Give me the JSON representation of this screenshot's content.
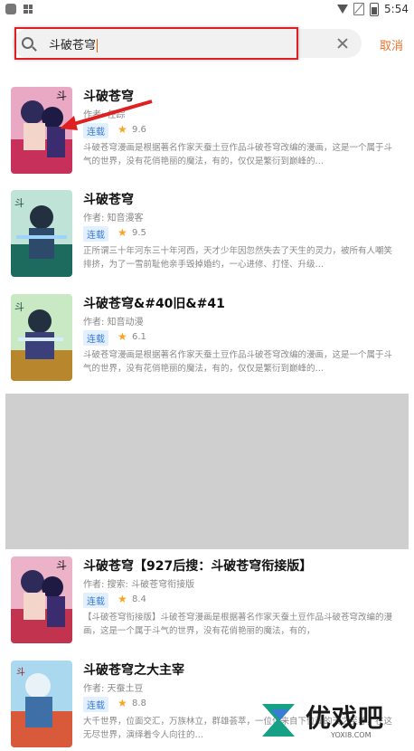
{
  "status": {
    "time": "5:54"
  },
  "search": {
    "query": "斗破苍穹",
    "cancel": "取消"
  },
  "results": [
    {
      "title": "斗破苍穹",
      "author": "作者: 任踪",
      "tag": "连载",
      "score": "9.6",
      "desc": "斗破苍穹漫画是根据著名作家天蚕土豆作品斗破苍穹改编的漫画，这是一个属于斗气的世界，没有花俏艳丽的魔法，有的，仅仅是繁衍到巅峰的…"
    },
    {
      "title": "斗破苍穹",
      "author": "作者: 知音漫客",
      "tag": "连载",
      "score": "9.5",
      "desc": "正所谓三十年河东三十年河西，天才少年因忽然失去了天生的灵力，被所有人嘲笑排挤，为了一雪前耻他亲手毁掉婚约，一心进修、打怪、升级…"
    },
    {
      "title": "斗破苍穹&#40旧&#41",
      "author": "作者: 知音动漫",
      "tag": "连载",
      "score": "6.1",
      "desc": "斗破苍穹漫画是根据著名作家天蚕土豆作品斗破苍穹改编的漫画，这是一个属于斗气的世界，没有花俏艳丽的魔法，有的，仅仅是繁衍到巅峰的…"
    },
    {
      "title": "斗破苍穹【927后搜：斗破苍穹衔接版】",
      "author": "作者: 搜索: 斗破苍穹衔接版",
      "tag": "连载",
      "score": "8.4",
      "desc": "【斗破苍穹衔接版】斗破苍穹漫画是根据著名作家天蚕土豆作品斗破苍穹改编的漫画，这是一个属于斗气的世界，没有花俏艳丽的魔法，有的，"
    },
    {
      "title": "斗破苍穹之大主宰",
      "author": "作者: 天蚕土豆",
      "tag": "连载",
      "score": "8.8",
      "desc": "大千世界，位面交汇，万族林立，群雄荟萃，一位位来自下位面的天之至尊，在这无尽世界，演绎着令人向往的…"
    }
  ],
  "watermark": {
    "text": "优戏吧",
    "site": "YOXI8.COM"
  },
  "colors": {
    "accent": "#e8742c",
    "highlight_box": "#e02020",
    "tag_blue": "#3a7bd5",
    "star": "#f5a623"
  }
}
